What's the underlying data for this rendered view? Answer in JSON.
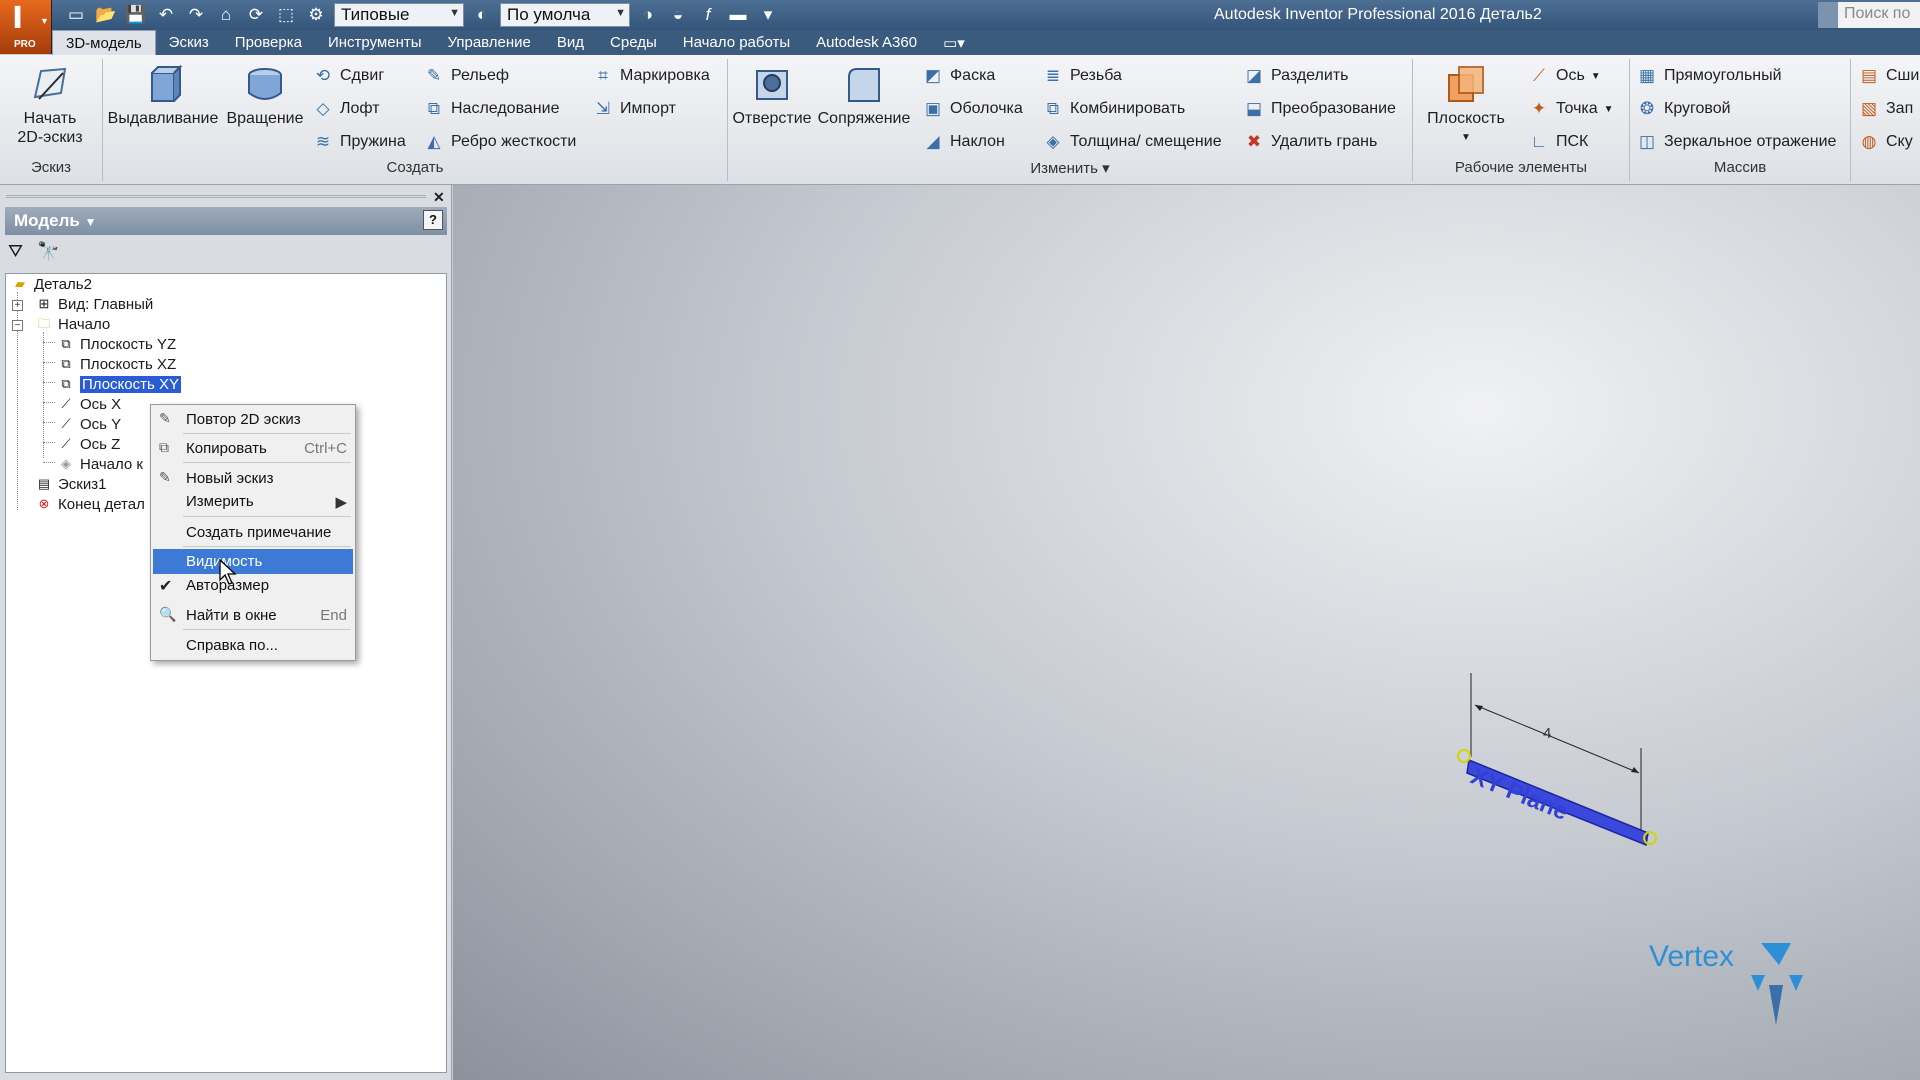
{
  "app": {
    "title": "Autodesk Inventor Professional 2016   Деталь2",
    "logo_letter": "I",
    "logo_badge": "PRO",
    "search_placeholder": "Поиск по",
    "material_combo": "Типовые",
    "appearance_combo": "По умолча"
  },
  "tabs": [
    {
      "label": "3D-модель",
      "active": true
    },
    {
      "label": "Эскиз"
    },
    {
      "label": "Проверка"
    },
    {
      "label": "Инструменты"
    },
    {
      "label": "Управление"
    },
    {
      "label": "Вид"
    },
    {
      "label": "Среды"
    },
    {
      "label": "Начало работы"
    },
    {
      "label": "Autodesk A360"
    }
  ],
  "ribbon": {
    "sketch": {
      "start_sketch": "Начать\n2D-эскиз",
      "panel": "Эскиз"
    },
    "create": {
      "extrude": "Выдавливание",
      "revolve": "Вращение",
      "sweep": "Сдвиг",
      "loft": "Лофт",
      "coil": "Пружина",
      "emboss": "Рельеф",
      "derive": "Наследование",
      "rib": "Ребро жесткости",
      "mark": "Маркировка",
      "import": "Импорт",
      "panel": "Создать"
    },
    "modify": {
      "hole": "Отверстие",
      "fillet": "Сопряжение",
      "chamfer": "Фаска",
      "shell": "Оболочка",
      "draft": "Наклон",
      "thread": "Резьба",
      "combine": "Комбинировать",
      "thicken": "Толщина/ смещение",
      "split": "Разделить",
      "direct": "Преобразование",
      "delete_face": "Удалить грань",
      "panel": "Изменить"
    },
    "work": {
      "plane": "Плоскость",
      "axis": "Ось",
      "point": "Точка",
      "ucs": "ПСК",
      "panel": "Рабочие элементы"
    },
    "pattern": {
      "rectangular": "Прямоугольный",
      "circular": "Круговой",
      "mirror": "Зеркальное отражение",
      "panel": "Массив"
    },
    "extra": {
      "a": "Сши",
      "b": "Зап",
      "c": "Ску"
    }
  },
  "browser": {
    "title": "Модель",
    "tree": [
      "Деталь2",
      "Вид: Главный",
      "Начало",
      "Плоскость YZ",
      "Плоскость XZ",
      "Плоскость XY",
      "Ось X",
      "Ось Y",
      "Ось Z",
      "Начало к",
      "Эскиз1",
      "Конец детал"
    ]
  },
  "context_menu": {
    "items": [
      {
        "label": "Повтор 2D эскиз"
      },
      {
        "label": "Копировать",
        "shortcut": "Ctrl+C"
      },
      {
        "label": "Новый эскиз"
      },
      {
        "label": "Измерить"
      },
      {
        "label": "Создать примечание"
      },
      {
        "label": "Видимость"
      },
      {
        "label": "Авторазмер"
      },
      {
        "label": "Найти в окне",
        "shortcut": "End"
      },
      {
        "label": "Справка по..."
      }
    ]
  },
  "viewport": {
    "plane_label": "XY Plane",
    "dimension": "4",
    "watermark": "Vertex"
  },
  "colors": {
    "title_bar": "#3f6189",
    "menu_highlight": "#3d7ad6",
    "tree_selection": "#2a5cd6",
    "plane_blue": "#3340d8"
  }
}
